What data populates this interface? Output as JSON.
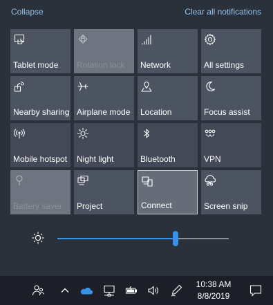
{
  "header": {
    "collapse_label": "Collapse",
    "clear_label": "Clear all notifications"
  },
  "tiles": [
    {
      "label": "Tablet mode",
      "icon": "tablet-icon",
      "state": "on"
    },
    {
      "label": "Rotation lock",
      "icon": "rotation-lock-icon",
      "state": "disabled"
    },
    {
      "label": "Network",
      "icon": "network-icon",
      "state": "on"
    },
    {
      "label": "All settings",
      "icon": "gear-icon",
      "state": "on"
    },
    {
      "label": "Nearby sharing",
      "icon": "nearby-sharing-icon",
      "state": "on"
    },
    {
      "label": "Airplane mode",
      "icon": "airplane-icon",
      "state": "on"
    },
    {
      "label": "Location",
      "icon": "location-icon",
      "state": "on"
    },
    {
      "label": "Focus assist",
      "icon": "moon-icon",
      "state": "on"
    },
    {
      "label": "Mobile hotspot",
      "icon": "hotspot-icon",
      "state": "off"
    },
    {
      "label": "Night light",
      "icon": "sun-icon",
      "state": "off"
    },
    {
      "label": "Bluetooth",
      "icon": "bluetooth-icon",
      "state": "off"
    },
    {
      "label": "VPN",
      "icon": "vpn-icon",
      "state": "off"
    },
    {
      "label": "Battery saver",
      "icon": "battery-saver-icon",
      "state": "disabled"
    },
    {
      "label": "Project",
      "icon": "project-icon",
      "state": "on"
    },
    {
      "label": "Connect",
      "icon": "connect-icon",
      "state": "selected"
    },
    {
      "label": "Screen snip",
      "icon": "screen-snip-icon",
      "state": "on"
    }
  ],
  "brightness": {
    "icon": "brightness-sun-icon",
    "level": 0.69
  },
  "taskbar": {
    "icons": [
      "people-icon",
      "chevron-up-icon",
      "onedrive-icon",
      "network-wired-icon",
      "battery-icon",
      "volume-icon",
      "pen-icon"
    ],
    "time": "10:38 AM",
    "date": "8/8/2019",
    "notification_icon": "action-center-icon"
  },
  "colors": {
    "accent": "#3a92e6",
    "link": "#8fc2ec",
    "tile": "#4c5361",
    "background": "#2b313b",
    "taskbar": "#1c1f27"
  }
}
